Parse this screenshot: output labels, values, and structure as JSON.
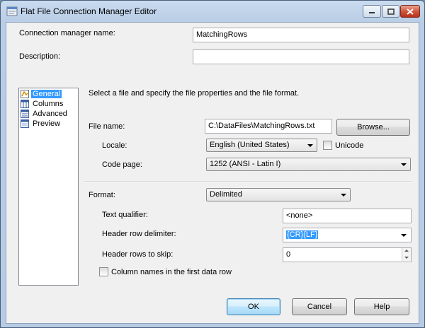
{
  "window": {
    "title": "Flat File Connection Manager Editor"
  },
  "connection": {
    "name_label": "Connection manager name:",
    "name_value": "MatchingRows",
    "description_label": "Description:",
    "description_value": ""
  },
  "nav": {
    "items": [
      {
        "label": "General",
        "icon": "general-icon",
        "selected": true
      },
      {
        "label": "Columns",
        "icon": "columns-icon",
        "selected": false
      },
      {
        "label": "Advanced",
        "icon": "advanced-icon",
        "selected": false
      },
      {
        "label": "Preview",
        "icon": "preview-icon",
        "selected": false
      }
    ]
  },
  "general": {
    "instruction": "Select a file and specify the file properties and the file format.",
    "file_name_label": "File name:",
    "file_name_value": "C:\\DataFiles\\MatchingRows.txt",
    "browse_label": "Browse...",
    "locale_label": "Locale:",
    "locale_value": "English (United States)",
    "unicode_label": "Unicode",
    "unicode_checked": false,
    "code_page_label": "Code page:",
    "code_page_value": "1252  (ANSI - Latin I)",
    "format_label": "Format:",
    "format_value": "Delimited",
    "text_qualifier_label": "Text qualifier:",
    "text_qualifier_value": "<none>",
    "header_delimiter_label": "Header row delimiter:",
    "header_delimiter_value": "{CR}{LF}",
    "header_skip_label": "Header rows to skip:",
    "header_skip_value": "0",
    "column_names_label": "Column names in the first data row",
    "column_names_checked": false
  },
  "footer": {
    "ok_label": "OK",
    "cancel_label": "Cancel",
    "help_label": "Help"
  }
}
